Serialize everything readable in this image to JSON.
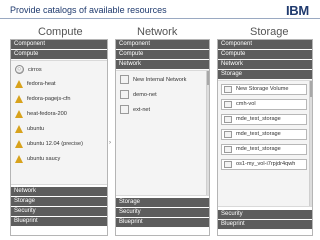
{
  "slide": {
    "title": "Provide catalogs of available resources",
    "logo_text": "IBM"
  },
  "columns": {
    "compute": "Compute",
    "network": "Network",
    "storage": "Storage"
  },
  "compute_panel": {
    "header_bars": [
      "Component",
      "Compute"
    ],
    "items": [
      {
        "label": "cirros",
        "icon": "disc-icon"
      },
      {
        "label": "fedora-heat",
        "icon": "linux-penguin-icon"
      },
      {
        "label": "fedora-pagejs-cfn",
        "icon": "linux-penguin-icon"
      },
      {
        "label": "heat-fedora-200",
        "icon": "linux-penguin-icon"
      },
      {
        "label": "ubuntu",
        "icon": "linux-penguin-icon"
      },
      {
        "label": "ubuntu 12.04 (precise)",
        "icon": "linux-penguin-icon"
      },
      {
        "label": "ubuntu saucy",
        "icon": "linux-penguin-icon"
      }
    ],
    "footer_bars": [
      "Network",
      "Storage",
      "Security",
      "Blueprint"
    ]
  },
  "network_panel": {
    "header_bars": [
      "Component",
      "Compute",
      "Network"
    ],
    "items": [
      {
        "label": "New Internal Network",
        "icon": "network-icon"
      },
      {
        "label": "demo-net",
        "icon": "network-icon"
      },
      {
        "label": "ext-net",
        "icon": "network-icon"
      }
    ],
    "footer_bars": [
      "Storage",
      "Security",
      "Blueprint"
    ]
  },
  "storage_panel": {
    "header_bars": [
      "Component",
      "Compute",
      "Network",
      "Storage"
    ],
    "items": [
      {
        "label": "New Storage Volume",
        "icon": "volume-icon"
      },
      {
        "label": "cmh-vol",
        "icon": "volume-icon"
      },
      {
        "label": "mde_test_storage",
        "icon": "volume-icon"
      },
      {
        "label": "mde_test_storage",
        "icon": "volume-icon"
      },
      {
        "label": "mde_test_storage",
        "icon": "volume-icon"
      },
      {
        "label": "os1-my_vol-i7rpjdr4qwh",
        "icon": "volume-icon"
      }
    ],
    "footer_bars": [
      "Security",
      "Blueprint"
    ]
  },
  "colors": {
    "title": "#1f3a6e",
    "bar": "#5d5d5d",
    "panel_bg": "#f4f4f4",
    "penguin": "#d8a21c"
  }
}
